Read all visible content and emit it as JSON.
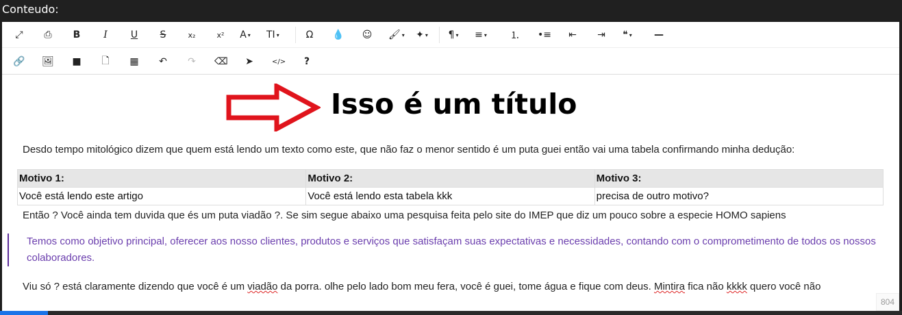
{
  "header": {
    "label": "Conteudo:"
  },
  "toolbar": {
    "row1": [
      {
        "name": "fullscreen-icon",
        "glyph": "⤢"
      },
      {
        "name": "print-icon",
        "glyph": "⎙"
      },
      {
        "name": "bold-icon",
        "glyph": "B"
      },
      {
        "name": "italic-icon",
        "glyph": "I"
      },
      {
        "name": "underline-icon",
        "glyph": "U"
      },
      {
        "name": "strikethrough-icon",
        "glyph": "S"
      },
      {
        "name": "subscript-icon",
        "glyph": "x₂"
      },
      {
        "name": "superscript-icon",
        "glyph": "x²"
      },
      {
        "name": "font-family-icon",
        "glyph": "A"
      },
      {
        "name": "font-size-icon",
        "glyph": "TI"
      },
      {
        "name": "special-chars-icon",
        "glyph": "Ω"
      },
      {
        "name": "color-icon",
        "glyph": "💧"
      },
      {
        "name": "emoticons-icon",
        "glyph": "☺"
      },
      {
        "name": "paint-brush-icon",
        "glyph": "🖌"
      },
      {
        "name": "magic-wand-icon",
        "glyph": "✦"
      },
      {
        "name": "paragraph-format-icon",
        "glyph": "¶"
      },
      {
        "name": "align-icon",
        "glyph": "≡"
      },
      {
        "name": "ordered-list-icon",
        "glyph": "⒈"
      },
      {
        "name": "unordered-list-icon",
        "glyph": "•≡"
      },
      {
        "name": "outdent-icon",
        "glyph": "⇤"
      },
      {
        "name": "indent-icon",
        "glyph": "⇥"
      },
      {
        "name": "quote-icon",
        "glyph": "❝"
      },
      {
        "name": "horizontal-line-icon",
        "glyph": "—"
      }
    ],
    "row2": [
      {
        "name": "link-icon",
        "glyph": "🔗"
      },
      {
        "name": "image-icon",
        "glyph": "🖼"
      },
      {
        "name": "video-icon",
        "glyph": "■"
      },
      {
        "name": "file-icon",
        "glyph": "🗋"
      },
      {
        "name": "table-icon",
        "glyph": "▦"
      },
      {
        "name": "undo-icon",
        "glyph": "↶"
      },
      {
        "name": "redo-icon",
        "glyph": "↷"
      },
      {
        "name": "clear-formatting-icon",
        "glyph": "⌫"
      },
      {
        "name": "select-all-icon",
        "glyph": "➤"
      },
      {
        "name": "code-view-icon",
        "glyph": "</>"
      },
      {
        "name": "help-icon",
        "glyph": "?"
      }
    ]
  },
  "content": {
    "title": "Isso é um título",
    "intro": "Desdo tempo mitológico dizem que quem está lendo um texto como este, que não faz o menor sentido é um puta guei então vai uma tabela confirmando minha dedução:",
    "table": {
      "headers": [
        "Motivo 1:",
        "Motivo 2:",
        "Motivo 3:"
      ],
      "row": [
        "Você está lendo este artigo",
        "Você está lendo esta tabela kkk",
        "precisa de outro motivo?"
      ]
    },
    "after_table": "Então ? Você ainda tem duvida que és um puta viadão ?. Se sim segue abaixo uma pesquisa feita pelo site do IMEP que diz um pouco sobre a especie HOMO sapiens",
    "quote": "Temos como objetivo principal, oferecer aos nosso clientes, produtos e serviços que satisfaçam suas expectativas e necessidades, contando com o comprometimento de todos os nossos colaboradores.",
    "closing_parts": {
      "p1": "Viu só ? está claramente dizendo que você é um ",
      "w1": "viadão",
      "p2": " da porra. olhe pelo lado bom meu fera, você é guei, tome água e fique com deus. ",
      "w2": "Mintira",
      "p3": " fica não ",
      "w3": "kkkk",
      "p4": " quero você não"
    },
    "counter": "804"
  },
  "colors": {
    "arrow": "#e0141c",
    "quote": "#6a3dad",
    "quote_border": "#5b2b9a",
    "accent": "#1a73e8"
  }
}
